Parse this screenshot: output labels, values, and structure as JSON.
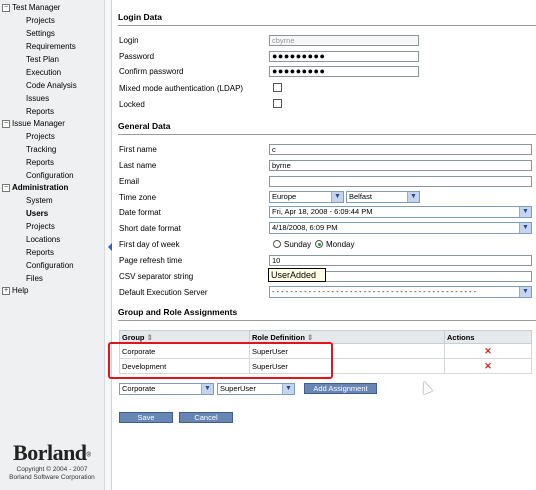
{
  "nav": {
    "test_manager": "Test Manager",
    "projects1": "Projects",
    "settings": "Settings",
    "requirements": "Requirements",
    "test_plan": "Test Plan",
    "execution": "Execution",
    "code_analysis": "Code Analysis",
    "issues": "Issues",
    "reports1": "Reports",
    "issue_manager": "Issue Manager",
    "projects2": "Projects",
    "tracking": "Tracking",
    "reports2": "Reports",
    "configuration1": "Configuration",
    "administration": "Administration",
    "system": "System",
    "users": "Users",
    "projects3": "Projects",
    "locations": "Locations",
    "reports3": "Reports",
    "configuration2": "Configuration",
    "files": "Files",
    "help": "Help",
    "toggle_minus": "−",
    "toggle_plus": "+"
  },
  "brand": {
    "logo": "Borland",
    "mark": "®",
    "copyright1": "Copyright © 2004 - 2007",
    "copyright2": "Borland Software Corporation"
  },
  "login": {
    "title": "Login Data",
    "login_label": "Login",
    "login_value": "cbyrne",
    "password_label": "Password",
    "password_value": "●●●●●●●●●",
    "confirm_label": "Confirm password",
    "confirm_value": "●●●●●●●●●",
    "ldap_label": "Mixed mode authentication (LDAP)",
    "locked_label": "Locked"
  },
  "general": {
    "title": "General Data",
    "first_name_label": "First name",
    "first_name_value": "c",
    "last_name_label": "Last name",
    "last_name_value": "byrne",
    "email_label": "Email",
    "email_value": "",
    "time_zone_label": "Time zone",
    "time_zone_region": "Europe",
    "time_zone_city": "Belfast",
    "date_format_label": "Date format",
    "date_format_value": "Fri, Apr 18, 2008 - 6:09:44 PM",
    "short_date_label": "Short date format",
    "short_date_value": "4/18/2008, 6:09 PM",
    "first_day_label": "First day of week",
    "sunday": "Sunday",
    "monday": "Monday",
    "first_day_selected": "Monday",
    "refresh_label": "Page refresh time",
    "refresh_value": "10",
    "csv_label": "CSV separator string",
    "csv_value": "",
    "exec_server_label": "Default Execution Server",
    "exec_server_value": "- - - - - - - - - - - - - - - - - - - - - - - - - - - - - - - - - - - - - - - - - - - - -",
    "tooltip": "UserAdded"
  },
  "roles": {
    "title": "Group and Role Assignments",
    "col_group": "Group",
    "col_role": "Role Definition",
    "col_actions": "Actions",
    "sort_icon": "⇕",
    "rows": [
      {
        "group": "Corporate",
        "role": "SuperUser",
        "action": "✕"
      },
      {
        "group": "Development",
        "role": "SuperUser",
        "action": "✕"
      }
    ],
    "group_select": "Corporate",
    "role_select": "SuperUser",
    "add_button": "Add Assignment"
  },
  "buttons": {
    "save": "Save",
    "cancel": "Cancel"
  },
  "icons": {
    "dropdown": "▼"
  }
}
